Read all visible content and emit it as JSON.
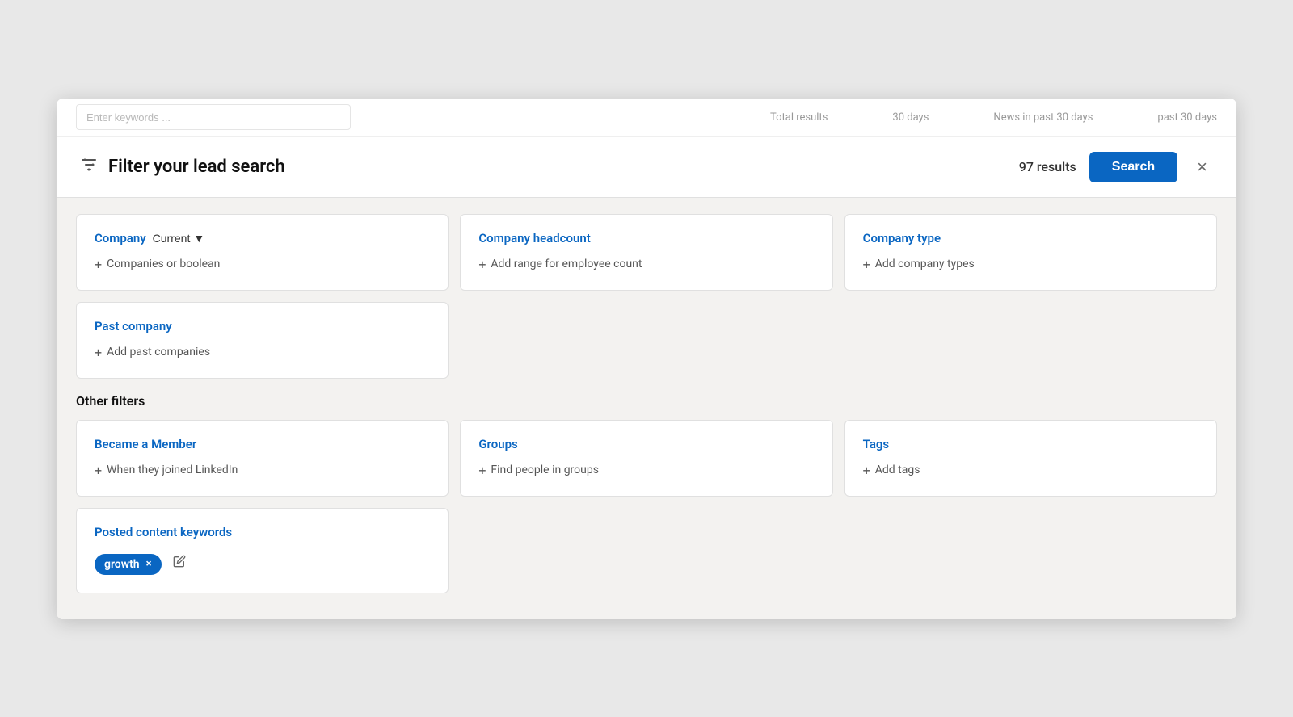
{
  "topBar": {
    "inputPlaceholder": "Enter keywords ...",
    "stats": [
      "Total results",
      "30 days",
      "News in past 30 days",
      "past 30 days"
    ]
  },
  "modal": {
    "title": "Filter your lead search",
    "resultsCount": "97 results",
    "searchLabel": "Search",
    "closeLabel": "×"
  },
  "filters": {
    "company": {
      "title": "Company",
      "badge": "Current",
      "badgeIcon": "▼",
      "action": "Companies or boolean"
    },
    "companyHeadcount": {
      "title": "Company headcount",
      "action": "Add range for employee count"
    },
    "companyType": {
      "title": "Company type",
      "action": "Add company types"
    },
    "pastCompany": {
      "title": "Past company",
      "action": "Add past companies"
    }
  },
  "otherFilters": {
    "sectionLabel": "Other filters",
    "becameMember": {
      "title": "Became a Member",
      "action": "When they joined LinkedIn"
    },
    "groups": {
      "title": "Groups",
      "action": "Find people in groups"
    },
    "tags": {
      "title": "Tags",
      "action": "Add tags"
    },
    "postedContent": {
      "title": "Posted content keywords",
      "keyword": "growth",
      "keywordCloseLabel": "×"
    }
  },
  "icons": {
    "filter": "⚙",
    "plus": "+",
    "edit": "✎"
  }
}
